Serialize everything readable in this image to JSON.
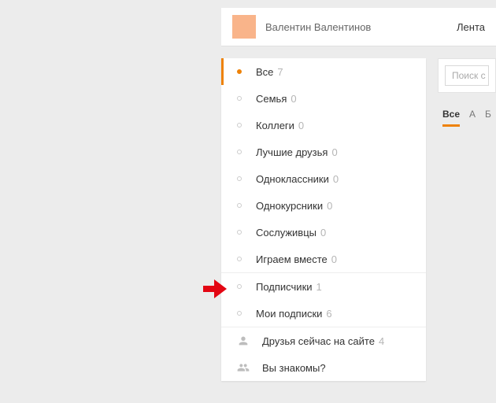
{
  "brand_color": "#EE8208",
  "header": {
    "username": "Валентин Валентинов",
    "feed_tab": "Лента"
  },
  "sidebar": {
    "groups": [
      [
        {
          "label": "Все",
          "count": "7",
          "active": true
        },
        {
          "label": "Семья",
          "count": "0"
        },
        {
          "label": "Коллеги",
          "count": "0"
        },
        {
          "label": "Лучшие друзья",
          "count": "0"
        },
        {
          "label": "Одноклассники",
          "count": "0"
        },
        {
          "label": "Однокурсники",
          "count": "0"
        },
        {
          "label": "Сослуживцы",
          "count": "0"
        },
        {
          "label": "Играем вместе",
          "count": "0"
        }
      ],
      [
        {
          "label": "Подписчики",
          "count": "1"
        },
        {
          "label": "Мои подписки",
          "count": "6"
        }
      ],
      [
        {
          "label": "Друзья сейчас на сайте",
          "count": "4",
          "icon": "person"
        },
        {
          "label": "Вы знакомы?",
          "icon": "people"
        }
      ]
    ]
  },
  "search": {
    "placeholder": "Поиск с"
  },
  "alpha": {
    "items": [
      "Все",
      "А",
      "Б"
    ],
    "activeIndex": 0
  }
}
